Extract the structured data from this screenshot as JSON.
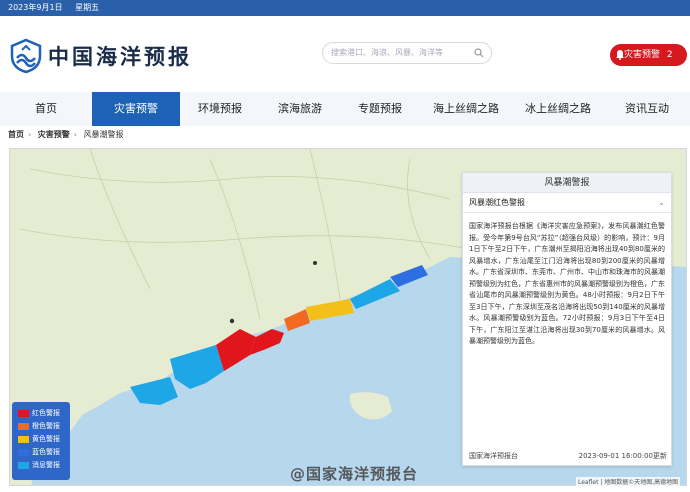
{
  "topbar": {
    "date": "2023年9月1日",
    "weekday": "星期五"
  },
  "header": {
    "site_name": "中国海洋预报",
    "search_placeholder": "搜索港口、海浪、风暴、海洋等",
    "alert_button": "灾害预警",
    "alert_count": "2"
  },
  "nav": {
    "items": [
      "首页",
      "灾害预警",
      "环境预报",
      "滨海旅游",
      "专题预报",
      "海上丝绸之路",
      "冰上丝绸之路",
      "资讯互动"
    ],
    "active": "灾害预警"
  },
  "breadcrumb": {
    "items": [
      "首页",
      "灾害预警",
      "风暴潮警报"
    ]
  },
  "panel": {
    "title": "风暴潮警报",
    "subtitle": "风暴潮红色警报",
    "body": "国家海洋预报台根据《海洋灾害应急预案》，发布风暴潮红色警报。受今年第9号台风“苏拉”（超强台风级）的影响，预计：9月1日下午至2日下午，广东潮州至揭阳沿海将出现40到80厘米的风暴增水，广东汕尾至江门沿海将出现80到200厘米的风暴增水。广东省深圳市、东莞市、广州市、中山市和珠海市的风暴潮预警级别为红色，广东省惠州市的风暴潮预警级别为橙色，广东省汕尾市的风暴潮预警级别为黄色。48小时预报：9月2日下午至3日下午，广东深圳至茂名沿海将出现50到140厘米的风暴增水。风暴潮预警级别为蓝色。72小时预报：9月3日下午至4日下午，广东阳江至湛江沿海将出现30到70厘米的风暴增水。风暴潮预警级别为蓝色。",
    "source": "国家海洋预报台",
    "time": "2023-09-01 16:00:00更新"
  },
  "legend": {
    "items": [
      {
        "label": "红色警报",
        "color": "#e0161c"
      },
      {
        "label": "橙色警报",
        "color": "#f26a21"
      },
      {
        "label": "黄色警报",
        "color": "#f3c01a"
      },
      {
        "label": "蓝色警报",
        "color": "#2d6fe0"
      },
      {
        "label": "消息警报",
        "color": "#1fa6e6"
      }
    ]
  },
  "watermark": "@国家海洋预报台",
  "attribution": "Leaflet | 地图数据©天地图,高德地图",
  "colors": {
    "primary": "#1e62b6",
    "alert": "#d6181f",
    "land": "#dfe8c6",
    "sea": "#b6d7ec"
  }
}
